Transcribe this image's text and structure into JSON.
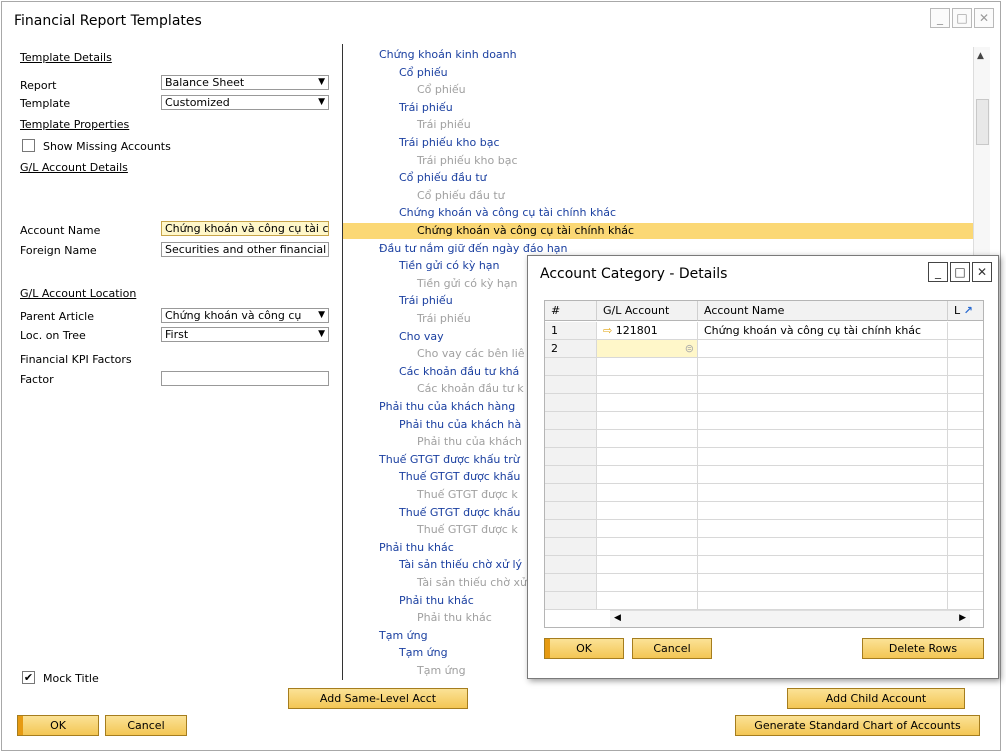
{
  "window": {
    "title": "Financial Report Templates",
    "controls": [
      "_",
      "□",
      "✕"
    ]
  },
  "left": {
    "template_details": "Template Details",
    "report_label": "Report",
    "report_value": "Balance Sheet",
    "template_label": "Template",
    "template_value": "Customized",
    "template_properties": "Template Properties",
    "show_missing": "Show Missing Accounts",
    "gl_account_details": "G/L Account Details",
    "account_name_label": "Account Name",
    "account_name_value": "Chứng khoán và công cụ tài chính khác",
    "foreign_name_label": "Foreign Name",
    "foreign_name_value": "Securities and other financial",
    "gl_account_location": "G/L Account Location",
    "parent_article_label": "Parent Article",
    "parent_article_value": "Chứng khoán và công cụ",
    "loc_tree_label": "Loc. on Tree",
    "loc_tree_value": "First",
    "kpi_factors": "Financial KPI Factors",
    "factor_label": "Factor",
    "factor_value": "",
    "mock_title": "Mock Title",
    "mock_title_checked": "✔"
  },
  "tree": [
    {
      "text": "Chứng khoán kinh doanh",
      "level": 0
    },
    {
      "text": "Cổ phiếu",
      "level": 1
    },
    {
      "text": "Cổ phiếu",
      "level": 2
    },
    {
      "text": "Trái phiếu",
      "level": 1
    },
    {
      "text": "Trái phiếu",
      "level": 2
    },
    {
      "text": "Trái phiếu kho bạc",
      "level": 1
    },
    {
      "text": "Trái phiếu kho bạc",
      "level": 2
    },
    {
      "text": "Cổ phiếu đầu tư",
      "level": 1
    },
    {
      "text": "Cổ phiếu đầu tư",
      "level": 2
    },
    {
      "text": "Chứng khoán và công cụ tài chính khác",
      "level": 1
    },
    {
      "text": "Chứng khoán và công cụ tài chính khác",
      "level": 2,
      "selected": true
    },
    {
      "text": "Đầu tư nắm giữ đến ngày đáo hạn",
      "level": 0
    },
    {
      "text": "Tiền gửi có kỳ hạn",
      "level": 1
    },
    {
      "text": "Tiền gửi có kỳ hạn",
      "level": 2
    },
    {
      "text": "Trái phiếu",
      "level": 1
    },
    {
      "text": "Trái phiếu",
      "level": 2
    },
    {
      "text": "Cho vay",
      "level": 1
    },
    {
      "text": "Cho vay các bên liê",
      "level": 2
    },
    {
      "text": "Các khoản đầu tư khá",
      "level": 1
    },
    {
      "text": "Các khoản đầu tư k",
      "level": 2
    },
    {
      "text": "Phải thu của khách hàng",
      "level": 0
    },
    {
      "text": "Phải thu của khách hà",
      "level": 1
    },
    {
      "text": "Phải thu của khách",
      "level": 2
    },
    {
      "text": "Thuế GTGT được khấu trừ",
      "level": 0
    },
    {
      "text": "Thuế GTGT được khấu",
      "level": 1
    },
    {
      "text": "Thuế GTGT được k",
      "level": 2
    },
    {
      "text": "Thuế GTGT được khấu",
      "level": 1
    },
    {
      "text": "Thuế GTGT được k",
      "level": 2
    },
    {
      "text": "Phải thu khác",
      "level": 0
    },
    {
      "text": "Tài sản thiếu chờ xử lý",
      "level": 1
    },
    {
      "text": "Tài sản thiếu chờ xử",
      "level": 2
    },
    {
      "text": "Phải thu khác",
      "level": 1
    },
    {
      "text": "Phải thu khác",
      "level": 2
    },
    {
      "text": "Tạm ứng",
      "level": 0
    },
    {
      "text": "Tạm ứng",
      "level": 1
    },
    {
      "text": "Tạm ứng",
      "level": 2
    }
  ],
  "buttons": {
    "add_same_level": "Add Same-Level Acct",
    "add_child": "Add Child Account",
    "generate": "Generate Standard Chart of Accounts",
    "ok": "OK",
    "cancel": "Cancel"
  },
  "dialog": {
    "title": "Account Category - Details",
    "controls": [
      "_",
      "□",
      "✕"
    ],
    "columns": [
      "#",
      "G/L Account",
      "Account Name",
      "L"
    ],
    "rows": [
      {
        "num": "1",
        "gl": "121801",
        "name": "Chứng khoán và công cụ tài chính khác"
      },
      {
        "num": "2",
        "gl": "",
        "name": ""
      }
    ],
    "ok": "OK",
    "cancel": "Cancel",
    "delete_rows": "Delete Rows"
  }
}
